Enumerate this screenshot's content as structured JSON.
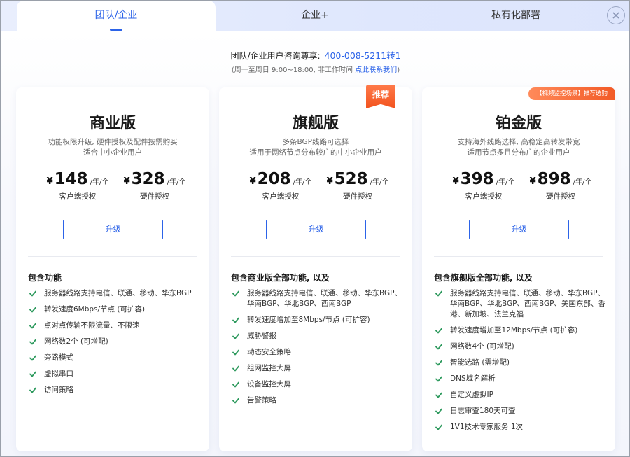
{
  "tabs": [
    {
      "label": "团队/企业"
    },
    {
      "label": "企业+"
    },
    {
      "label": "私有化部署"
    }
  ],
  "consult": {
    "text": "团队/企业用户咨询尊享:",
    "phone": "400-008-5211转1",
    "hours_prefix": "(周一至周日 9:00~18:00, 非工作时间 ",
    "hours_link": "点此联系我们",
    "hours_suffix": ")"
  },
  "upgrade_label": "升级",
  "cards": [
    {
      "title": "商业版",
      "desc1": "功能权限升级, 硬件授权及配件按需购买",
      "desc2": "适合中小企业用户",
      "prices": [
        {
          "currency": "¥",
          "amount": "148",
          "unit": "/年/个",
          "type": "客户端授权"
        },
        {
          "currency": "¥",
          "amount": "328",
          "unit": "/年/个",
          "type": "硬件授权"
        }
      ],
      "features_title": "包含功能",
      "features": [
        "服务器线路支持电信、联通、移动、华东BGP",
        "转发速度6Mbps/节点 (可扩容)",
        "点对点传输不限流量、不限速",
        "网络数2个 (可增配)",
        "旁路模式",
        "虚拟串口",
        "访问策略"
      ]
    },
    {
      "title": "旗舰版",
      "ribbon": "推荐",
      "desc1": "多条BGP线路可选择",
      "desc2": "适用于网络节点分布较广的中小企业用户",
      "prices": [
        {
          "currency": "¥",
          "amount": "208",
          "unit": "/年/个",
          "type": "客户端授权"
        },
        {
          "currency": "¥",
          "amount": "528",
          "unit": "/年/个",
          "type": "硬件授权"
        }
      ],
      "features_title": "包含商业版全部功能, 以及",
      "features": [
        "服务器线路支持电信、联通、移动、华东BGP、华南BGP、华北BGP、西南BGP",
        "转发速度增加至8Mbps/节点 (可扩容)",
        "威胁警报",
        "动态安全策略",
        "组网监控大屏",
        "设备监控大屏",
        "告警策略"
      ]
    },
    {
      "title": "铂金版",
      "ribbon": "【视频监控场景】推荐选购",
      "desc1": "支持海外线路选择, 高稳定高转发带宽",
      "desc2": "适用节点多且分布广的企业用户",
      "prices": [
        {
          "currency": "¥",
          "amount": "398",
          "unit": "/年/个",
          "type": "客户端授权"
        },
        {
          "currency": "¥",
          "amount": "898",
          "unit": "/年/个",
          "type": "硬件授权"
        }
      ],
      "features_title": "包含旗舰版全部功能, 以及",
      "features": [
        "服务器线路支持电信、联通、移动、华东BGP、华南BGP、华北BGP、西南BGP、美国东部、香港、新加坡、法兰克福",
        "转发速度增加至12Mbps/节点 (可扩容)",
        "网络数4个 (可增配)",
        "智能选路 (需增配)",
        "DNS域名解析",
        "自定义虚拟IP",
        "日志审查180天可查",
        "1V1技术专家服务 1次"
      ]
    }
  ],
  "colors": {
    "accent": "#2c63e8",
    "check": "#2e9a5e",
    "ribbon": "#f2531e"
  },
  "icons": {
    "close": "close-icon",
    "check": "check-icon"
  }
}
